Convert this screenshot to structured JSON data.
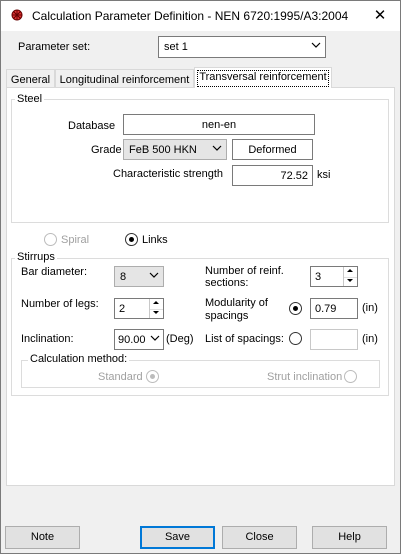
{
  "window": {
    "title": "Calculation Parameter Definition - NEN 6720:1995/A3:2004",
    "close_glyph": "✕"
  },
  "parameter_set": {
    "label": "Parameter set:",
    "value": "set 1"
  },
  "tabs": [
    {
      "label": "General"
    },
    {
      "label": "Longitudinal reinforcement"
    },
    {
      "label": "Transversal reinforcement"
    }
  ],
  "steel": {
    "title": "Steel",
    "database_label": "Database",
    "database_value": "nen-en",
    "grade_label": "Grade",
    "grade_value": "FeB 500 HKN",
    "grade_type": "Deformed",
    "char_strength_label": "Characteristic strength",
    "char_strength_value": "72.52",
    "char_strength_unit": "ksi"
  },
  "reinf_type": {
    "spiral_label": "Spiral",
    "links_label": "Links"
  },
  "stirrups": {
    "title": "Stirrups",
    "bar_diameter_label": "Bar diameter:",
    "bar_diameter_value": "8",
    "reinf_sections_label_1": "Number of reinf.",
    "reinf_sections_label_2": "sections:",
    "reinf_sections_value": "3",
    "legs_label": "Number of legs:",
    "legs_value": "2",
    "modularity_label_1": "Modularity of",
    "modularity_label_2": "spacings",
    "modularity_value": "0.79",
    "modularity_unit": "(in)",
    "inclination_label": "Inclination:",
    "inclination_value": "90.00",
    "inclination_unit": "(Deg)",
    "list_spacings_label": "List of spacings:",
    "list_spacings_value": "",
    "list_spacings_unit": "(in)",
    "calc_method": {
      "title": "Calculation method:",
      "standard_label": "Standard",
      "strut_label": "Strut inclination"
    }
  },
  "buttons": {
    "note": "Note",
    "save": "Save",
    "close": "Close",
    "help": "Help"
  }
}
